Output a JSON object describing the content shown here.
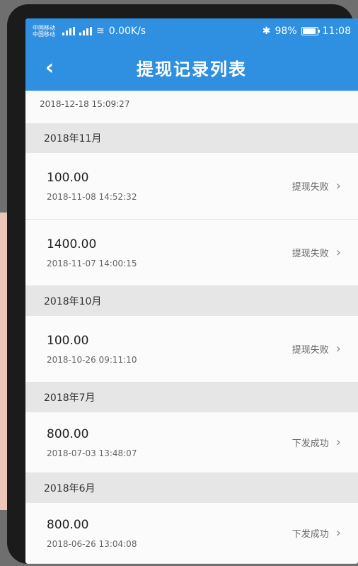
{
  "status_bar": {
    "carrier1": "中国移动",
    "carrier2": "中国移动",
    "speed": "0.00K/s",
    "battery_percent": "98%",
    "time": "11:08"
  },
  "navbar": {
    "title": "提现记录列表",
    "back_icon": "chevron-left-icon"
  },
  "list": {
    "top_timestamp": "2018-12-18 15:09:27",
    "groups": [
      {
        "month": "2018年11月",
        "records": [
          {
            "amount": "100.00",
            "time": "2018-11-08 14:52:32",
            "status": "提现失败"
          },
          {
            "amount": "1400.00",
            "time": "2018-11-07 14:00:15",
            "status": "提现失败"
          }
        ]
      },
      {
        "month": "2018年10月",
        "records": [
          {
            "amount": "100.00",
            "time": "2018-10-26 09:11:10",
            "status": "提现失败"
          }
        ]
      },
      {
        "month": "2018年7月",
        "records": [
          {
            "amount": "800.00",
            "time": "2018-07-03 13:48:07",
            "status": "下发成功"
          }
        ]
      },
      {
        "month": "2018年6月",
        "records": [
          {
            "amount": "800.00",
            "time": "2018-06-26 13:04:08",
            "status": "下发成功"
          }
        ]
      }
    ]
  },
  "colors": {
    "primary": "#2f8fe0"
  }
}
